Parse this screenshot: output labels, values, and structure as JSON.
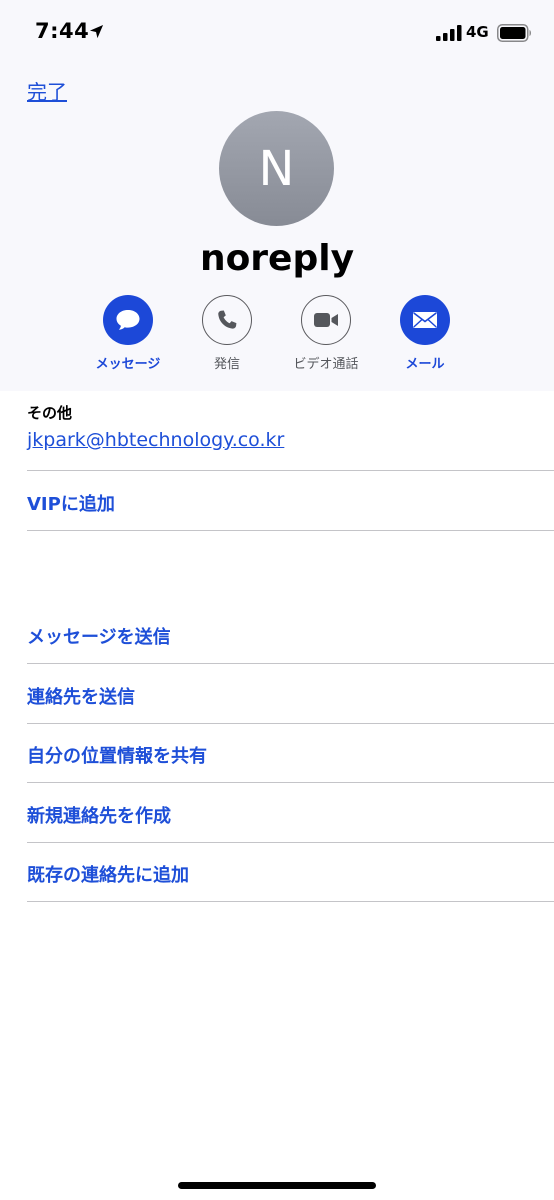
{
  "status_bar": {
    "time": "7:44",
    "network": "4G",
    "icons": [
      "location-arrow-icon",
      "cellular-signal-icon",
      "battery-icon"
    ]
  },
  "nav": {
    "done_label": "完了"
  },
  "contact": {
    "initial": "N",
    "name": "noreply"
  },
  "actions": [
    {
      "label": "メッセージ",
      "icon": "message-bubble-icon",
      "enabled": true
    },
    {
      "label": "発信",
      "icon": "phone-icon",
      "enabled": false
    },
    {
      "label": "ビデオ通話",
      "icon": "video-camera-icon",
      "enabled": false
    },
    {
      "label": "メール",
      "icon": "envelope-icon",
      "enabled": true
    }
  ],
  "email_section": {
    "label": "その他",
    "email": "jkpark@hbtechnology.co.kr"
  },
  "vip_row": {
    "label": "VIPに追加"
  },
  "menu_rows": [
    {
      "label": "メッセージを送信"
    },
    {
      "label": "連絡先を送信"
    },
    {
      "label": "自分の位置情報を共有"
    },
    {
      "label": "新規連絡先を作成"
    },
    {
      "label": "既存の連絡先に追加"
    }
  ],
  "colors": {
    "accent_blue": "#1c48d8",
    "link_blue": "#1e4fd8",
    "header_bg": "#f8f8fc",
    "avatar_gray": "#959aa3",
    "divider": "#c4c4c8"
  }
}
